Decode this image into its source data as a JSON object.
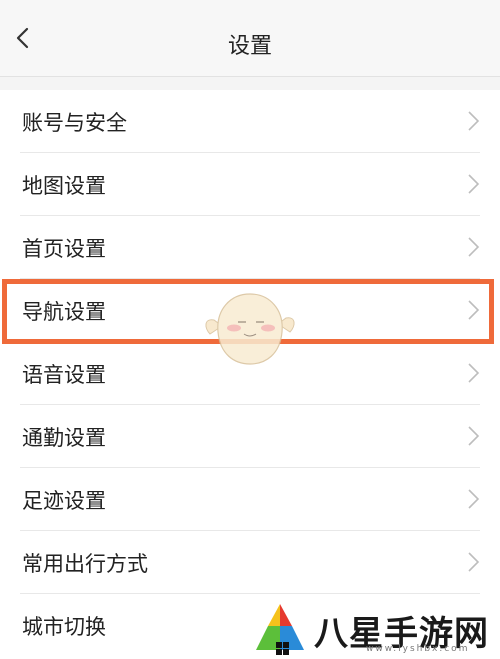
{
  "header": {
    "title": "设置"
  },
  "menu": {
    "items": [
      {
        "label": "账号与安全"
      },
      {
        "label": "地图设置"
      },
      {
        "label": "首页设置"
      },
      {
        "label": "导航设置"
      },
      {
        "label": "语音设置"
      },
      {
        "label": "通勤设置"
      },
      {
        "label": "足迹设置"
      },
      {
        "label": "常用出行方式"
      },
      {
        "label": "城市切换"
      }
    ]
  },
  "annotation": {
    "highlighted_item": "导航设置",
    "color": "#ef6a3a"
  },
  "watermark": {
    "logo_text": "八星手游网",
    "url": "www.lyshbx.com"
  },
  "icons": {
    "back": "chevron-left-icon",
    "row_arrow": "chevron-right-icon"
  }
}
